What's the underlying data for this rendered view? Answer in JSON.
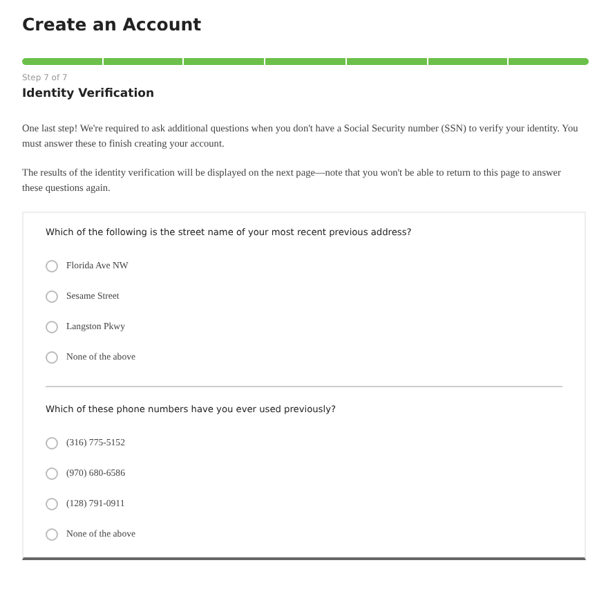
{
  "title": "Create an Account",
  "progress": {
    "segments": [
      {
        "complete": true
      },
      {
        "complete": true
      },
      {
        "complete": true
      },
      {
        "complete": true
      },
      {
        "complete": true
      },
      {
        "complete": true
      },
      {
        "complete": true
      }
    ]
  },
  "step": "Step 7 of 7",
  "heading": "Identity Verification",
  "paragraphs": [
    "One last step! We're required to ask additional questions when you don't have a Social Security number (SSN) to verify your identity. You must answer these to finish creating your account.",
    "The results of the identity verification will be displayed on the next page—note that you won't be able to return to this page to answer these questions again."
  ],
  "questions": [
    {
      "text": "Which of the following is the street name of your most recent previous address?",
      "options": [
        {
          "label": "Florida Ave NW",
          "selected": false
        },
        {
          "label": "Sesame Street",
          "selected": false
        },
        {
          "label": "Langston Pkwy",
          "selected": false
        },
        {
          "label": "None of the above",
          "selected": false
        }
      ]
    },
    {
      "text": "Which of these phone numbers have you ever used previously?",
      "options": [
        {
          "label": "(316) 775-5152",
          "selected": false
        },
        {
          "label": "(970) 680-6586",
          "selected": false
        },
        {
          "label": "(128) 791-0911",
          "selected": false
        },
        {
          "label": "None of the above",
          "selected": false
        }
      ]
    }
  ]
}
